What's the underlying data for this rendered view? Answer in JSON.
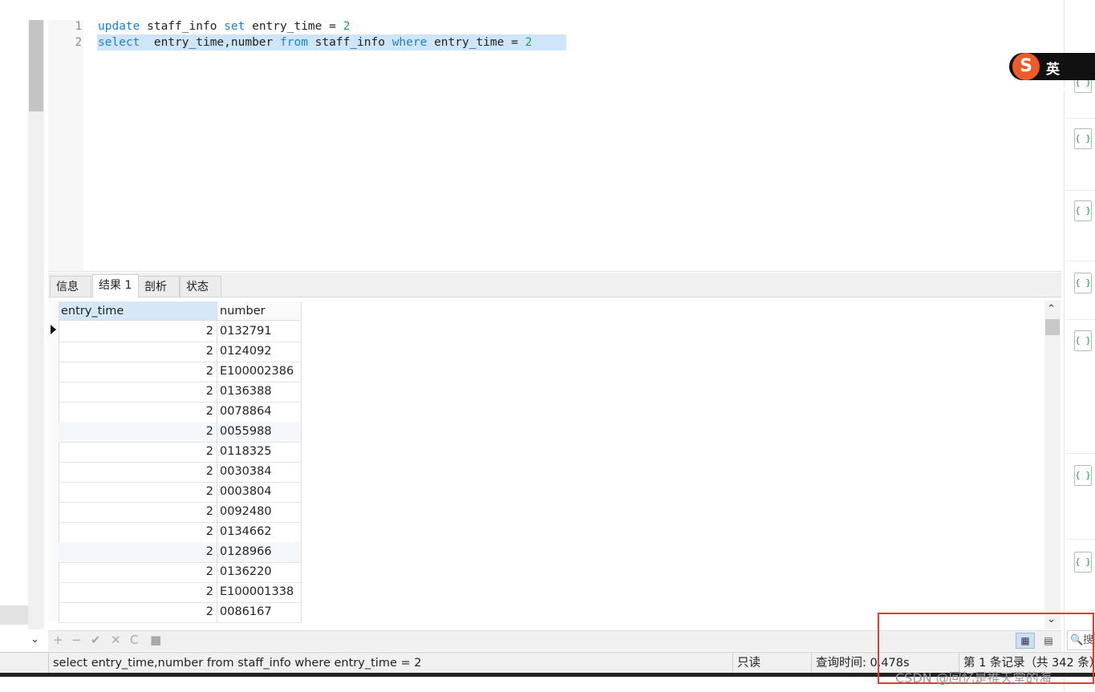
{
  "editor": {
    "lines": [
      {
        "no": "1",
        "tokens": [
          {
            "t": "update",
            "c": "kw"
          },
          {
            "t": " staff_info ",
            "c": ""
          },
          {
            "t": "set",
            "c": "kw"
          },
          {
            "t": " entry_time = ",
            "c": ""
          },
          {
            "t": "2",
            "c": "num"
          }
        ]
      },
      {
        "no": "2",
        "tokens": [
          {
            "t": "select",
            "c": "kw"
          },
          {
            "t": "  entry_time,number ",
            "c": ""
          },
          {
            "t": "from",
            "c": "kw"
          },
          {
            "t": " staff_info ",
            "c": ""
          },
          {
            "t": "where",
            "c": "kw"
          },
          {
            "t": " entry_time = ",
            "c": ""
          },
          {
            "t": "2",
            "c": "num"
          }
        ]
      }
    ]
  },
  "tabs": [
    "信息",
    "结果 1",
    "剖析",
    "状态"
  ],
  "active_tab": "结果 1",
  "grid": {
    "columns": [
      "entry_time",
      "number"
    ],
    "rows": [
      [
        "2",
        "0132791"
      ],
      [
        "2",
        "0124092"
      ],
      [
        "2",
        "E100002386"
      ],
      [
        "2",
        "0136388"
      ],
      [
        "2",
        "0078864"
      ],
      [
        "2",
        "0055988"
      ],
      [
        "2",
        "0118325"
      ],
      [
        "2",
        "0030384"
      ],
      [
        "2",
        "0003804"
      ],
      [
        "2",
        "0092480"
      ],
      [
        "2",
        "0134662"
      ],
      [
        "2",
        "0128966"
      ],
      [
        "2",
        "0136220"
      ],
      [
        "2",
        "E100001338"
      ],
      [
        "2",
        "0086167"
      ]
    ]
  },
  "toolbar": {
    "buttons": [
      {
        "name": "add-record-button",
        "glyph": "+"
      },
      {
        "name": "delete-record-button",
        "glyph": "−"
      },
      {
        "name": "apply-button",
        "glyph": "✔"
      },
      {
        "name": "discard-button",
        "glyph": "✕"
      },
      {
        "name": "refresh-button",
        "glyph": "C"
      },
      {
        "name": "stop-button",
        "glyph": "■"
      }
    ],
    "grid_view_icon": "▦",
    "form_view_icon": "▤",
    "search_text": "🔍搜"
  },
  "ime": {
    "logo": "S",
    "text": "英 •,"
  },
  "sidebar_icon_glyph": "{ }",
  "status": {
    "sql": "select  entry_time,number from staff_info where entry_time = 2",
    "readonly": "只读",
    "query_time": "查询时间: 0.478s",
    "record_info": "第 1 条记录（共 342 条）"
  },
  "watermark": "CSDN @回忆是推天堂的海"
}
